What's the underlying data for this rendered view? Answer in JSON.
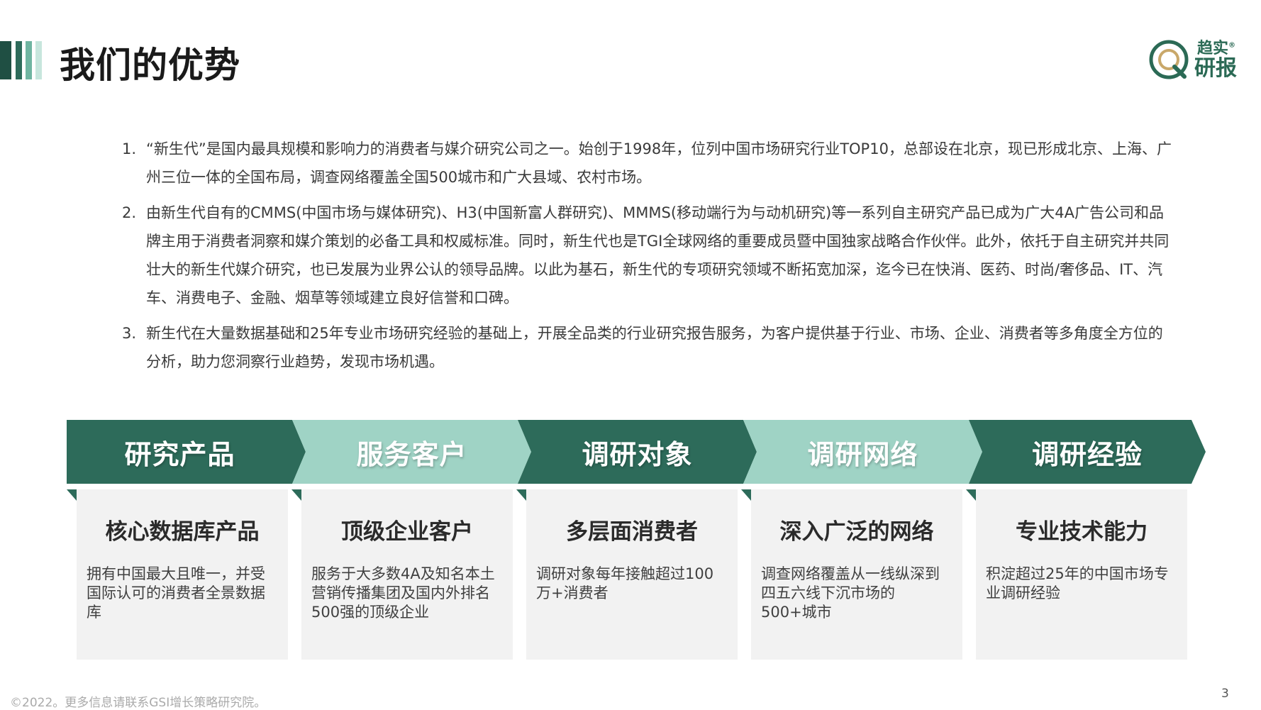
{
  "header": {
    "title": "我们的优势",
    "accent_colors": [
      "#1f4f43",
      "#2d6b5a",
      "#6fb5a1",
      "#c7e6dd"
    ]
  },
  "logo": {
    "line1": "趋实",
    "line2": "研报",
    "reg": "®",
    "color": "#2b6a55",
    "accent": "#c9a86a"
  },
  "points": [
    {
      "num": "1.",
      "text": "“新生代”是国内最具规模和影响力的消费者与媒介研究公司之一。始创于1998年，位列中国市场研究行业TOP10，总部设在北京，现已形成北京、上海、广州三位一体的全国布局，调查网络覆盖全国500城市和广大县域、农村市场。"
    },
    {
      "num": "2.",
      "text": "由新生代自有的CMMS(中国市场与媒体研究)、H3(中国新富人群研究)、MMMS(移动端行为与动机研究)等一系列自主研究产品已成为广大4A广告公司和品牌主用于消费者洞察和媒介策划的必备工具和权威标准。同时，新生代也是TGI全球网络的重要成员暨中国独家战略合作伙伴。此外，依托于自主研究并共同壮大的新生代媒介研究，也已发展为业界公认的领导品牌。以此为基石，新生代的专项研究领域不断拓宽加深，迄今已在快消、医药、时尚/奢侈品、IT、汽车、消费电子、金融、烟草等领域建立良好信誉和口碑。"
    },
    {
      "num": "3.",
      "text": "新生代在大量数据基础和25年专业市场研究经验的基础上，开展全品类的行业研究报告服务，为客户提供基于行业、市场、企业、消费者等多角度全方位的分析，助力您洞察行业趋势，发现市场机遇。"
    }
  ],
  "chevrons": [
    {
      "label": "研究产品",
      "tone": "dark"
    },
    {
      "label": "服务客户",
      "tone": "light"
    },
    {
      "label": "调研对象",
      "tone": "dark"
    },
    {
      "label": "调研网络",
      "tone": "light"
    },
    {
      "label": "调研经验",
      "tone": "dark"
    }
  ],
  "cards": [
    {
      "title": "核心数据库产品",
      "body": "拥有中国最大且唯一，并受国际认可的消费者全景数据库"
    },
    {
      "title": "顶级企业客户",
      "body": "服务于大多数4A及知名本土营销传播集团及国内外排名500强的顶级企业"
    },
    {
      "title": "多层面消费者",
      "body": "调研对象每年接触超过100万+消费者"
    },
    {
      "title": "深入广泛的网络",
      "body": "调查网络覆盖从一线纵深到四五六线下沉市场的500+城市"
    },
    {
      "title": "专业技术能力",
      "body": "积淀超过25年的中国市场专业调研经验"
    }
  ],
  "footer": {
    "note": "©2022。更多信息请联系GSI增长策略研究院。",
    "page": "3"
  },
  "colors": {
    "dark_green": "#2d6b5a",
    "light_green": "#9fd3c5",
    "card_bg": "#f2f2f2"
  }
}
